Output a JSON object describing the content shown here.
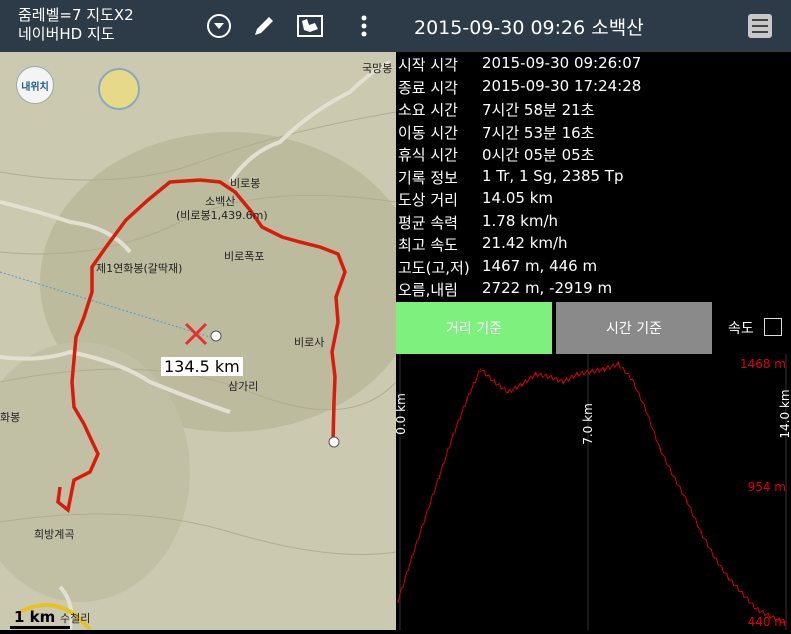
{
  "topbar": {
    "zoom_line1": "줌레벨=7 지도X2",
    "zoom_line2": "네이버HD 지도",
    "title": "2015-09-30 09:26 소백산",
    "icons": [
      "dropdown-icon",
      "pencil-icon",
      "map-icon",
      "more-icon",
      "menu-icon"
    ]
  },
  "map": {
    "locate_label": "내위치",
    "labels": {
      "gukmangbong": "국망봉",
      "birobong": "비로봉",
      "sobaeksan": "소백산",
      "birobong_alt": "(비로봉1,439.6m)",
      "jeil": "제1연화봉(갈딱재)",
      "biropokpo": "비로폭포",
      "birosa": "비로사",
      "samgari": "삼가리",
      "hwabong": "화봉",
      "huibang": "희방계곡",
      "sucheolli": "수철리"
    },
    "distance_label": "134.5 km",
    "scale_label": "1 km"
  },
  "info": [
    {
      "label": "시작 시각",
      "value": "2015-09-30 09:26:07"
    },
    {
      "label": "종료 시각",
      "value": "2015-09-30 17:24:28"
    },
    {
      "label": "소요 시간",
      "value": "7시간 58분 21초"
    },
    {
      "label": "이동 시간",
      "value": "7시간 53분 16초"
    },
    {
      "label": "휴식 시간",
      "value": "0시간 05분 05초"
    },
    {
      "label": "기록 정보",
      "value": "1 Tr, 1 Sg, 2385 Tp"
    },
    {
      "label": "도상 거리",
      "value": "14.05 km"
    },
    {
      "label": "평균 속력",
      "value": "1.78 km/h"
    },
    {
      "label": "최고 속도",
      "value": "21.42 km/h"
    },
    {
      "label": "고도(고,저)",
      "value": "1467 m, 446 m"
    },
    {
      "label": "오름,내림",
      "value": "2722 m, -2919 m"
    }
  ],
  "buttons": {
    "distance": "거리 기준",
    "time": "시간 기준",
    "speed_label": "속도"
  },
  "chart_data": {
    "type": "line",
    "xlabels": [
      "0.0 km",
      "7.0 km",
      "14.0 km"
    ],
    "ylabels": [
      "1468 m",
      "954 m",
      "440 m"
    ],
    "xlim": [
      0,
      14.05
    ],
    "ylim": [
      440,
      1468
    ],
    "x": [
      0,
      0.5,
      1,
      1.5,
      2,
      2.5,
      3,
      3.5,
      4,
      4.5,
      5,
      5.5,
      6,
      6.5,
      7,
      7.5,
      8,
      8.5,
      9,
      9.5,
      10,
      10.5,
      11,
      11.5,
      12,
      12.5,
      13,
      13.5,
      14.05
    ],
    "y": [
      530,
      700,
      860,
      1020,
      1180,
      1320,
      1440,
      1390,
      1350,
      1380,
      1420,
      1410,
      1390,
      1420,
      1430,
      1440,
      1460,
      1400,
      1280,
      1130,
      1020,
      920,
      800,
      700,
      620,
      560,
      500,
      470,
      446
    ],
    "color": "#d00000"
  }
}
